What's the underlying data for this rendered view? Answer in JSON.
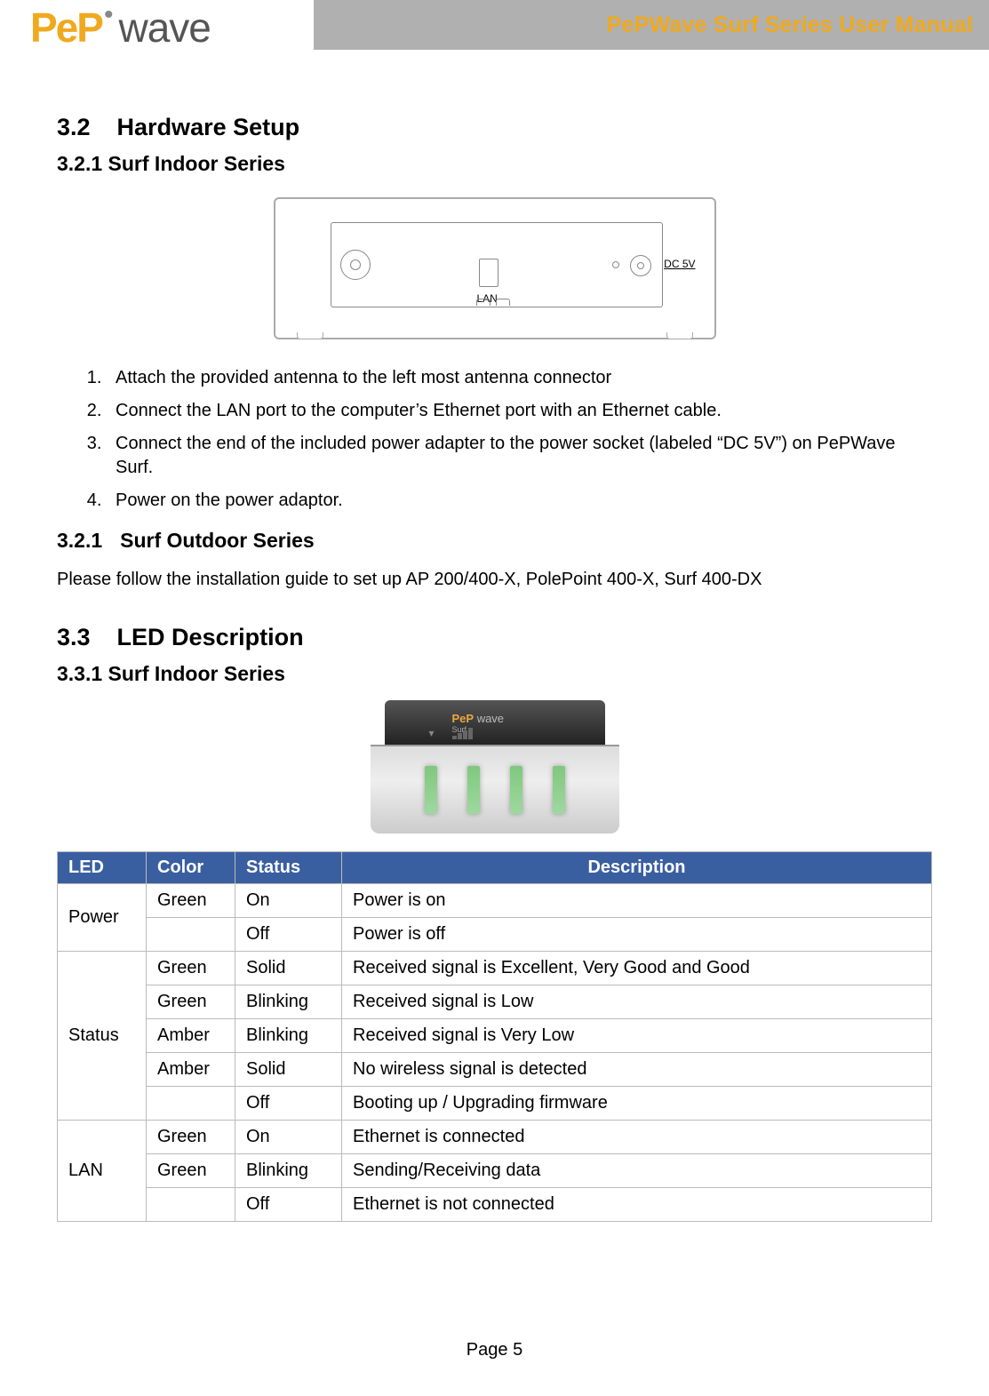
{
  "header": {
    "title": "PePWave Surf Series User Manual",
    "logo_prefix": "PeP",
    "logo_suffix": "wave"
  },
  "sections": {
    "s32": {
      "num": "3.2",
      "title": "Hardware Setup"
    },
    "s321": {
      "title": "3.2.1 Surf Indoor Series"
    },
    "s321b": {
      "num": "3.2.1",
      "title": "Surf Outdoor Series"
    },
    "s321b_body": "Please follow the installation guide to set up AP 200/400-X, PolePoint 400-X, Surf 400-DX",
    "s33": {
      "num": "3.3",
      "title": "LED Description"
    },
    "s331": {
      "title": "3.3.1 Surf Indoor Series"
    }
  },
  "figure1": {
    "lan_label": "LAN",
    "dc_label": "DC 5V"
  },
  "steps": [
    "Attach the provided antenna to the left most antenna connector",
    "Connect the LAN port to the computer’s Ethernet port with an Ethernet cable.",
    "Connect the end of the included power adapter to the power socket (labeled “DC 5V”) on PePWave Surf.",
    "Power on the power adaptor."
  ],
  "figure2": {
    "brand_pep": "PeP",
    "brand_wave": " wave",
    "sub": "Surf"
  },
  "table": {
    "headers": {
      "led": "LED",
      "color": "Color",
      "status": "Status",
      "desc": "Description"
    },
    "groups": [
      {
        "led": "Power",
        "rows": [
          {
            "color": "Green",
            "status": "On",
            "desc": "Power is on"
          },
          {
            "color": "",
            "status": "Off",
            "desc": "Power is off"
          }
        ]
      },
      {
        "led": "Status",
        "rows": [
          {
            "color": "Green",
            "status": "Solid",
            "desc": "Received signal is Excellent, Very Good and Good"
          },
          {
            "color": "Green",
            "status": "Blinking",
            "desc": "Received signal is Low"
          },
          {
            "color": "Amber",
            "status": "Blinking",
            "desc": "Received signal is Very Low"
          },
          {
            "color": "Amber",
            "status": "Solid",
            "desc": "No wireless signal is detected"
          },
          {
            "color": "",
            "status": "Off",
            "desc": "Booting up / Upgrading firmware"
          }
        ]
      },
      {
        "led": "LAN",
        "rows": [
          {
            "color": "Green",
            "status": "On",
            "desc": "Ethernet is connected"
          },
          {
            "color": "Green",
            "status": "Blinking",
            "desc": "Sending/Receiving data"
          },
          {
            "color": "",
            "status": "Off",
            "desc": "Ethernet is not connected"
          }
        ]
      }
    ]
  },
  "footer": "Page 5"
}
